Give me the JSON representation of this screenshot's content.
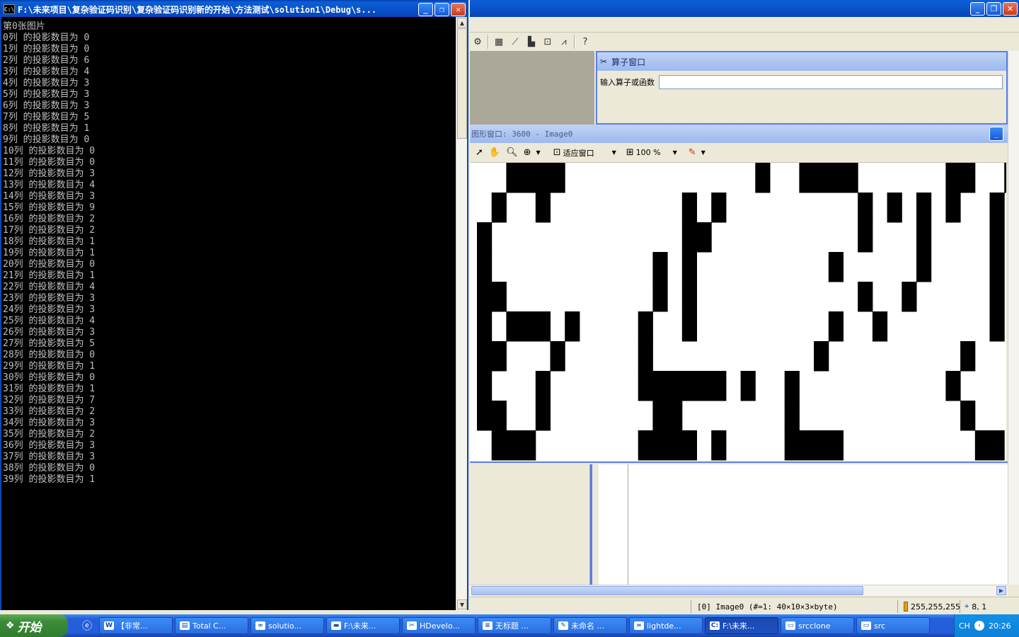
{
  "console": {
    "title": "F:\\未来项目\\复杂验证码识别\\复杂验证码识别新的开始\\方法测试\\solution1\\Debug\\s...",
    "icon": "console-icon",
    "lines": [
      "第0张图片",
      "0列 的投影数目为 0",
      "1列 的投影数目为 0",
      "2列 的投影数目为 6",
      "3列 的投影数目为 4",
      "4列 的投影数目为 3",
      "5列 的投影数目为 3",
      "6列 的投影数目为 3",
      "7列 的投影数目为 5",
      "8列 的投影数目为 1",
      "9列 的投影数目为 0",
      "10列 的投影数目为 0",
      "11列 的投影数目为 0",
      "12列 的投影数目为 3",
      "13列 的投影数目为 4",
      "14列 的投影数目为 3",
      "15列 的投影数目为 9",
      "16列 的投影数目为 2",
      "17列 的投影数目为 2",
      "18列 的投影数目为 1",
      "19列 的投影数目为 1",
      "20列 的投影数目为 0",
      "21列 的投影数目为 1",
      "22列 的投影数目为 4",
      "23列 的投影数目为 3",
      "24列 的投影数目为 3",
      "25列 的投影数目为 4",
      "26列 的投影数目为 3",
      "27列 的投影数目为 5",
      "28列 的投影数目为 0",
      "29列 的投影数目为 1",
      "30列 的投影数目为 0",
      "31列 的投影数目为 1",
      "32列 的投影数目为 7",
      "33列 的投影数目为 2",
      "34列 的投影数目为 3",
      "35列 的投影数目为 2",
      "36列 的投影数目为 3",
      "37列 的投影数目为 3",
      "38列 的投影数目为 0",
      "39列 的投影数目为 1"
    ]
  },
  "hdevelop": {
    "operator_window": {
      "title": "算子窗口",
      "input_label": "输入算子或函数",
      "input_value": ""
    },
    "graphics_window": {
      "title": "图形窗口: 3600 - Image0",
      "fit_label": "适应窗口",
      "zoom_label": "100 %"
    },
    "status": {
      "image_info": "[0] Image0 (#=1: 40×10×3×byte)",
      "rgb": "255,255,255",
      "position": "8, 1"
    }
  },
  "taskbar": {
    "start_label": "开始",
    "tasks": [
      {
        "label": "【非常...",
        "icon": "word-icon"
      },
      {
        "label": "Total C...",
        "icon": "total-commander-icon"
      },
      {
        "label": "solutio...",
        "icon": "visual-studio-icon"
      },
      {
        "label": "F:\\未来...",
        "icon": "folder-icon"
      },
      {
        "label": "HDevelo...",
        "icon": "hdevelop-icon"
      },
      {
        "label": "无标题 ...",
        "icon": "notepad-icon"
      },
      {
        "label": "未命名 ...",
        "icon": "paint-icon"
      },
      {
        "label": "lightde...",
        "icon": "visual-studio-icon"
      },
      {
        "label": "F:\\未来...",
        "icon": "console-icon"
      },
      {
        "label": "srcclone",
        "icon": "window-icon"
      },
      {
        "label": "src",
        "icon": "window-icon"
      }
    ],
    "active_index": 8,
    "tray": {
      "lang": "CH",
      "time": "20:26"
    }
  }
}
